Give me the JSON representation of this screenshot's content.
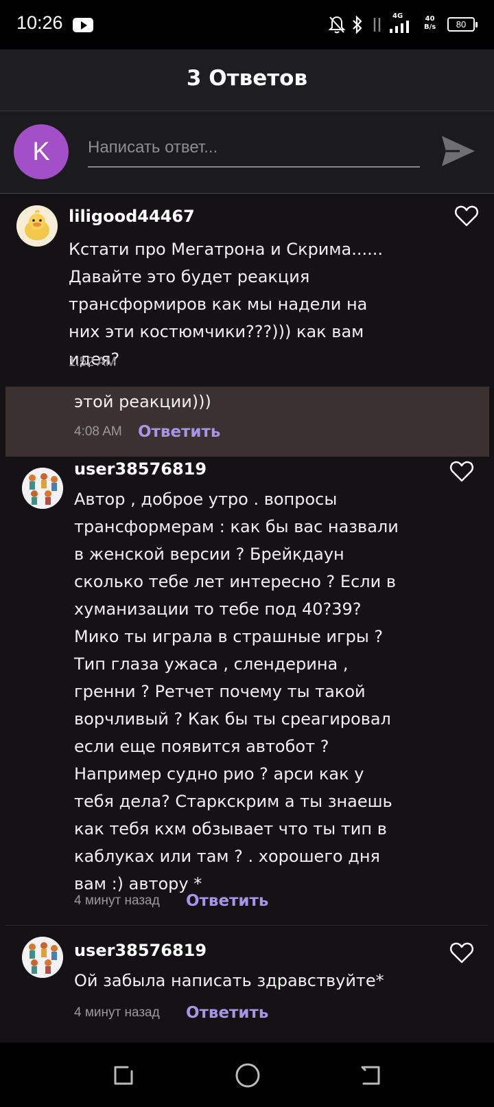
{
  "status_bar": {
    "time": "10:26",
    "network_type": "4G",
    "speed_value": "40",
    "speed_unit": "B/s",
    "battery": "80"
  },
  "header": {
    "title": "3 Ответов"
  },
  "reply_bar": {
    "avatar_letter": "K",
    "placeholder": "Написать ответ..."
  },
  "comments": [
    {
      "username": "liligood44467",
      "text": "Кстати про Мегатрона и Скрима......\nДавайте это будет реакция трансформиров как мы надели на них эти костюмчики???))) как вам идея?",
      "time": "1:52 AM"
    },
    {
      "text": "этой реакции)))",
      "time": "4:08 AM",
      "reply_label": "Ответить"
    },
    {
      "username": "user38576819",
      "text": "Автор , доброе утро .  вопросы трансформерам : как бы вас назвали в женской версии ? Брейкдаун сколько тебе лет интересно ? Если в хуманизации то тебе под 40?39? Мико ты играла в страшные игры ? Тип глаза ужаса , слендерина , гренни ? Ретчет почему ты такой ворчливый ? Как бы ты среагировал если еще появится автобот ? Например судно рио ?  арси как у тебя дела? Старкскрим а ты знаешь как тебя кхм обзывает что ты тип в каблуках или там ? . хорошего дня вам :) автору *",
      "time": "4 минут назад",
      "reply_label": "Ответить"
    },
    {
      "username": "user38576819",
      "text": "Ой забыла написать здравствуйте*",
      "time": "4 минут назад",
      "reply_label": "Ответить"
    }
  ],
  "colors": {
    "accent": "#a795e8",
    "avatar_k": "#a34fc7",
    "highlight": "#3a3130"
  }
}
